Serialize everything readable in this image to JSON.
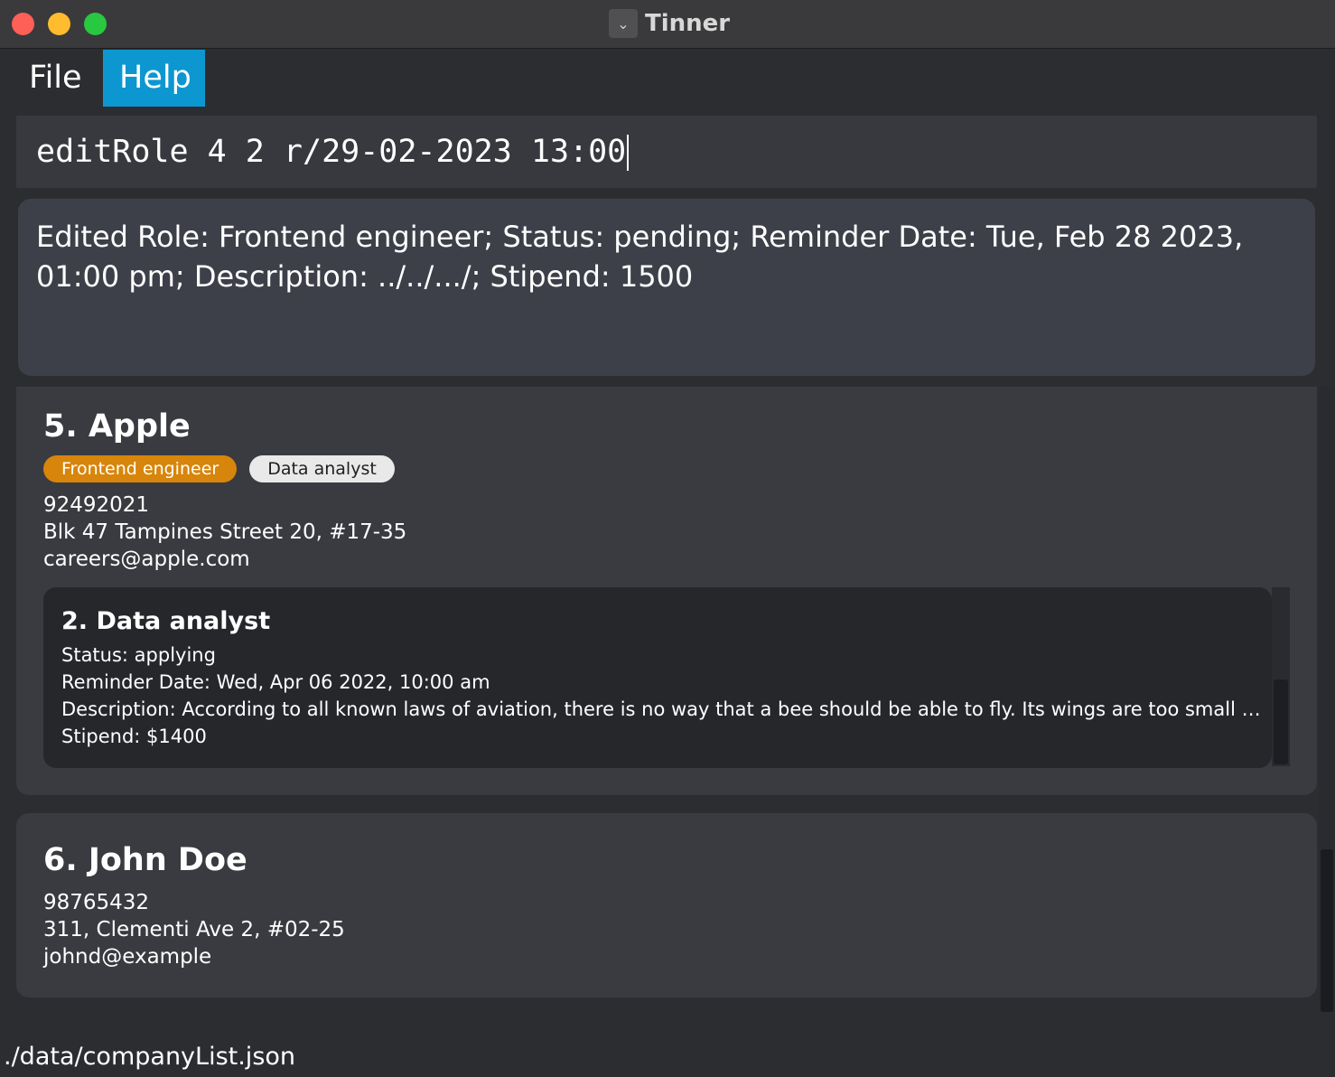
{
  "window": {
    "title": "Tinner",
    "app_icon": "chevron-down-icon"
  },
  "menu": {
    "items": [
      {
        "label": "File"
      },
      {
        "label": "Help"
      }
    ],
    "active_color": "#0c97d1"
  },
  "command": {
    "value": "editRole 4 2 r/29-02-2023 13:00"
  },
  "result": {
    "text": "Edited Role: Frontend engineer; Status: pending; Reminder Date: Tue, Feb 28 2023, 01:00 pm; Description: ../../.../; Stipend: 1500"
  },
  "companies": [
    {
      "name": "5.  Apple",
      "tags": [
        "Frontend engineer",
        "Data analyst"
      ],
      "tag_colors": [
        "#d7850b",
        "#e9e9e9"
      ],
      "phone": "92492021",
      "address": "Blk 47 Tampines Street 20, #17-35",
      "email": "careers@apple.com",
      "role": {
        "title": "2.  Data analyst",
        "status": "Status: applying",
        "reminder": "Reminder Date: Wed, Apr 06 2022, 10:00 am",
        "description": "Description: According to all known laws of aviation, there is no way that a bee should be able to fly. Its wings are too small to ge...",
        "stipend": "Stipend: $1400"
      }
    },
    {
      "name": "6.  John Doe",
      "phone": "98765432",
      "address": "311, Clementi Ave 2, #02-25",
      "email": "johnd@example"
    }
  ],
  "status_bar": {
    "path": "./data/companyList.json"
  }
}
